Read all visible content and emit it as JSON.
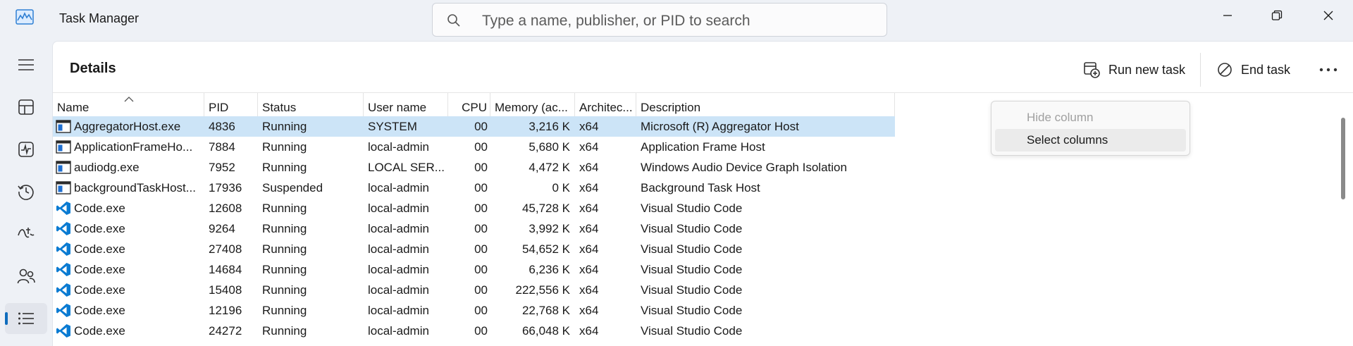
{
  "window": {
    "title": "Task Manager",
    "search_placeholder": "Type a name, publisher, or PID to search",
    "buttons": [
      "minimize",
      "restore",
      "close"
    ]
  },
  "nav": {
    "items": [
      {
        "icon": "hamburger-menu-icon"
      },
      {
        "icon": "processes-icon"
      },
      {
        "icon": "performance-icon"
      },
      {
        "icon": "app-history-icon"
      },
      {
        "icon": "startup-apps-icon"
      },
      {
        "icon": "users-icon"
      },
      {
        "icon": "details-icon",
        "active": true
      }
    ]
  },
  "page": {
    "title": "Details",
    "run_new_task": "Run new task",
    "end_task": "End task"
  },
  "table": {
    "columns": [
      "Name",
      "PID",
      "Status",
      "User name",
      "CPU",
      "Memory (ac...",
      "Architec...",
      "Description"
    ],
    "rows": [
      {
        "icon": "app-window",
        "name": "AggregatorHost.exe",
        "pid": "4836",
        "status": "Running",
        "user": "SYSTEM",
        "cpu": "00",
        "memory": "3,216 K",
        "arch": "x64",
        "desc": "Microsoft (R) Aggregator Host",
        "selected": true
      },
      {
        "icon": "app-window",
        "name": "ApplicationFrameHo...",
        "pid": "7884",
        "status": "Running",
        "user": "local-admin",
        "cpu": "00",
        "memory": "5,680 K",
        "arch": "x64",
        "desc": "Application Frame Host"
      },
      {
        "icon": "app-window",
        "name": "audiodg.exe",
        "pid": "7952",
        "status": "Running",
        "user": "LOCAL SER...",
        "cpu": "00",
        "memory": "4,472 K",
        "arch": "x64",
        "desc": "Windows Audio Device Graph Isolation"
      },
      {
        "icon": "app-window",
        "name": "backgroundTaskHost...",
        "pid": "17936",
        "status": "Suspended",
        "user": "local-admin",
        "cpu": "00",
        "memory": "0 K",
        "arch": "x64",
        "desc": "Background Task Host"
      },
      {
        "icon": "vscode",
        "name": "Code.exe",
        "pid": "12608",
        "status": "Running",
        "user": "local-admin",
        "cpu": "00",
        "memory": "45,728 K",
        "arch": "x64",
        "desc": "Visual Studio Code"
      },
      {
        "icon": "vscode",
        "name": "Code.exe",
        "pid": "9264",
        "status": "Running",
        "user": "local-admin",
        "cpu": "00",
        "memory": "3,992 K",
        "arch": "x64",
        "desc": "Visual Studio Code"
      },
      {
        "icon": "vscode",
        "name": "Code.exe",
        "pid": "27408",
        "status": "Running",
        "user": "local-admin",
        "cpu": "00",
        "memory": "54,652 K",
        "arch": "x64",
        "desc": "Visual Studio Code"
      },
      {
        "icon": "vscode",
        "name": "Code.exe",
        "pid": "14684",
        "status": "Running",
        "user": "local-admin",
        "cpu": "00",
        "memory": "6,236 K",
        "arch": "x64",
        "desc": "Visual Studio Code"
      },
      {
        "icon": "vscode",
        "name": "Code.exe",
        "pid": "15408",
        "status": "Running",
        "user": "local-admin",
        "cpu": "00",
        "memory": "222,556 K",
        "arch": "x64",
        "desc": "Visual Studio Code"
      },
      {
        "icon": "vscode",
        "name": "Code.exe",
        "pid": "12196",
        "status": "Running",
        "user": "local-admin",
        "cpu": "00",
        "memory": "22,768 K",
        "arch": "x64",
        "desc": "Visual Studio Code"
      },
      {
        "icon": "vscode",
        "name": "Code.exe",
        "pid": "24272",
        "status": "Running",
        "user": "local-admin",
        "cpu": "00",
        "memory": "66,048 K",
        "arch": "x64",
        "desc": "Visual Studio Code"
      }
    ]
  },
  "context_menu": {
    "items": [
      {
        "label": "Hide column",
        "disabled": true
      },
      {
        "label": "Select columns",
        "hover": true
      }
    ]
  },
  "colors": {
    "accent": "#0f6cbd",
    "selected_row": "#cce4f7",
    "vscode_blue": "#0a7bd2"
  }
}
